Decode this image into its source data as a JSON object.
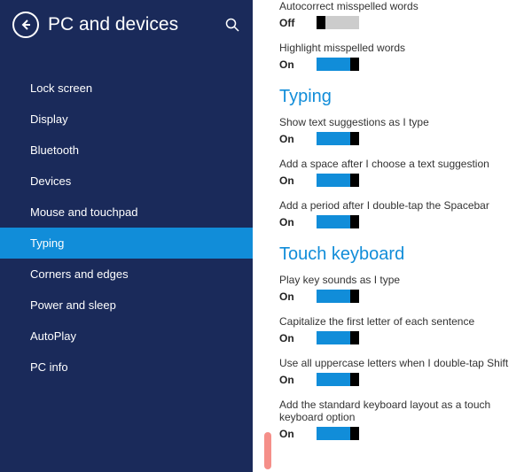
{
  "header": {
    "title": "PC and devices"
  },
  "sidebar": {
    "items": [
      {
        "label": "Lock screen",
        "selected": false
      },
      {
        "label": "Display",
        "selected": false
      },
      {
        "label": "Bluetooth",
        "selected": false
      },
      {
        "label": "Devices",
        "selected": false
      },
      {
        "label": "Mouse and touchpad",
        "selected": false
      },
      {
        "label": "Typing",
        "selected": true
      },
      {
        "label": "Corners and edges",
        "selected": false
      },
      {
        "label": "Power and sleep",
        "selected": false
      },
      {
        "label": "AutoPlay",
        "selected": false
      },
      {
        "label": "PC info",
        "selected": false
      }
    ]
  },
  "content": {
    "groups": [
      {
        "title": null,
        "settings": [
          {
            "label": "Autocorrect misspelled words",
            "state": "Off",
            "on": false
          },
          {
            "label": "Highlight misspelled words",
            "state": "On",
            "on": true
          }
        ]
      },
      {
        "title": "Typing",
        "settings": [
          {
            "label": "Show text suggestions as I type",
            "state": "On",
            "on": true
          },
          {
            "label": "Add a space after I choose a text suggestion",
            "state": "On",
            "on": true
          },
          {
            "label": "Add a period after I double-tap the Spacebar",
            "state": "On",
            "on": true
          }
        ]
      },
      {
        "title": "Touch keyboard",
        "settings": [
          {
            "label": "Play key sounds as I type",
            "state": "On",
            "on": true
          },
          {
            "label": "Capitalize the first letter of each sentence",
            "state": "On",
            "on": true
          },
          {
            "label": "Use all uppercase letters when I double-tap Shift",
            "state": "On",
            "on": true
          },
          {
            "label": "Add the standard keyboard layout as a touch keyboard option",
            "state": "On",
            "on": true
          }
        ]
      }
    ]
  }
}
